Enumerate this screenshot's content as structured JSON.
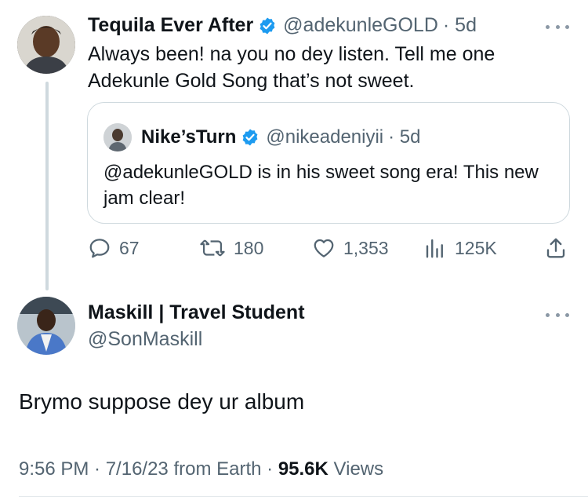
{
  "tweet": {
    "name": "Tequila Ever After",
    "handle": "@adekunleGOLD",
    "age": "· 5d",
    "text": "Always been! na you no dey listen. Tell me one Adekunle Gold Song that’s not sweet.",
    "quote": {
      "name": "Nike’sTurn",
      "handle": "@nikeadeniyii",
      "age": "· 5d",
      "text": "@adekunleGOLD is in his sweet song era! This new jam clear!"
    },
    "stats": {
      "replies": "67",
      "retweets": "180",
      "likes": "1,353",
      "views": "125K"
    }
  },
  "reply": {
    "name": "Maskill | Travel Student",
    "handle": "@SonMaskill",
    "text": "Brymo suppose dey ur album",
    "time": "9:56 PM · 7/16/23 from Earth ·",
    "views_count": "95.6K",
    "views_label": "Views"
  },
  "icons": {
    "verified": "verified-badge-icon",
    "reply": "reply-icon",
    "retweet": "retweet-icon",
    "like": "heart-icon",
    "views": "views-chart-icon",
    "share": "share-icon",
    "more": "more-icon"
  },
  "colors": {
    "verified": "#1d9bf0",
    "secondary_text": "#536471",
    "primary_text": "#0f1419",
    "border": "#cfd9de"
  }
}
